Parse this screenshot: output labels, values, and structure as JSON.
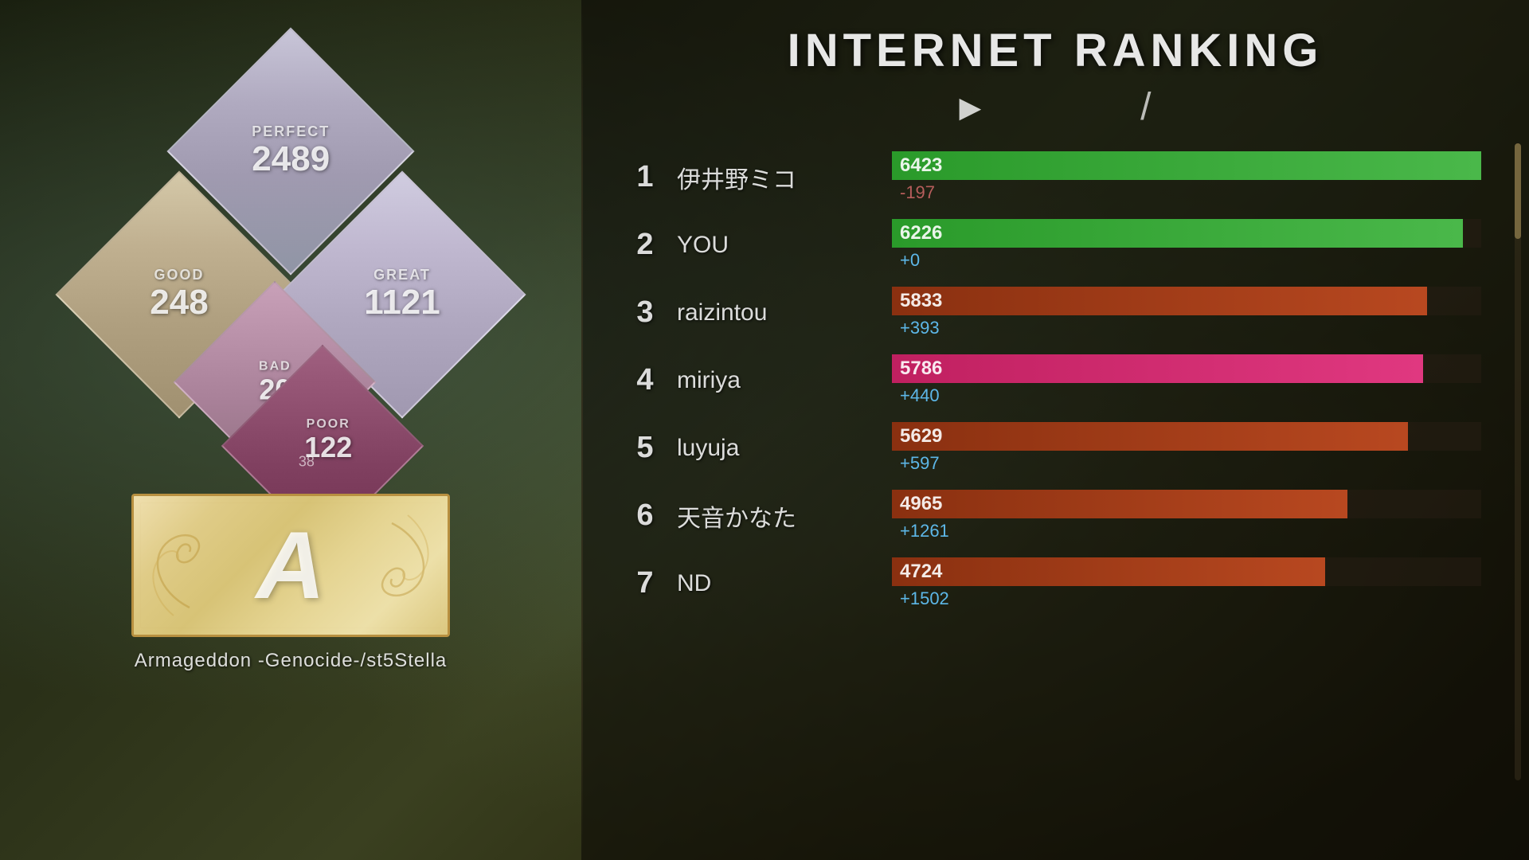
{
  "background": {
    "color": "#1a2010"
  },
  "left_panel": {
    "tiles": {
      "perfect": {
        "label": "PERFECT",
        "value": "2489"
      },
      "good": {
        "label": "GOOD",
        "value": "248"
      },
      "great": {
        "label": "GREAT",
        "value": "1121"
      },
      "bad": {
        "label": "BAD",
        "value": "20"
      },
      "poor": {
        "label": "POOR",
        "value": "122",
        "sub_value": "38"
      }
    },
    "grade": "A",
    "song_title": "Armageddon -Genocide-/st5Stella"
  },
  "right_panel": {
    "title": "INTERNET RANKING",
    "nav_arrow": "▶",
    "nav_slash": "/",
    "rankings": [
      {
        "rank": "1",
        "name": "伊井野ミコ",
        "score": "6423",
        "diff": "-197",
        "bar_class": "bar-green bar-6423",
        "diff_class": "negative"
      },
      {
        "rank": "2",
        "name": "YOU",
        "score": "6226",
        "diff": "+0",
        "bar_class": "bar-green bar-6226",
        "diff_class": ""
      },
      {
        "rank": "3",
        "name": "raizintou",
        "score": "5833",
        "diff": "+393",
        "bar_class": "bar-orange bar-5833",
        "diff_class": ""
      },
      {
        "rank": "4",
        "name": "miriya",
        "score": "5786",
        "diff": "+440",
        "bar_class": "bar-pink bar-5786",
        "diff_class": ""
      },
      {
        "rank": "5",
        "name": "luyuja",
        "score": "5629",
        "diff": "+597",
        "bar_class": "bar-orange bar-5629",
        "diff_class": ""
      },
      {
        "rank": "6",
        "name": "天音かなた",
        "score": "4965",
        "diff": "+1261",
        "bar_class": "bar-orange bar-4965",
        "diff_class": ""
      },
      {
        "rank": "7",
        "name": "ND",
        "score": "4724",
        "diff": "+1502",
        "bar_class": "bar-orange bar-4724",
        "diff_class": ""
      }
    ]
  }
}
